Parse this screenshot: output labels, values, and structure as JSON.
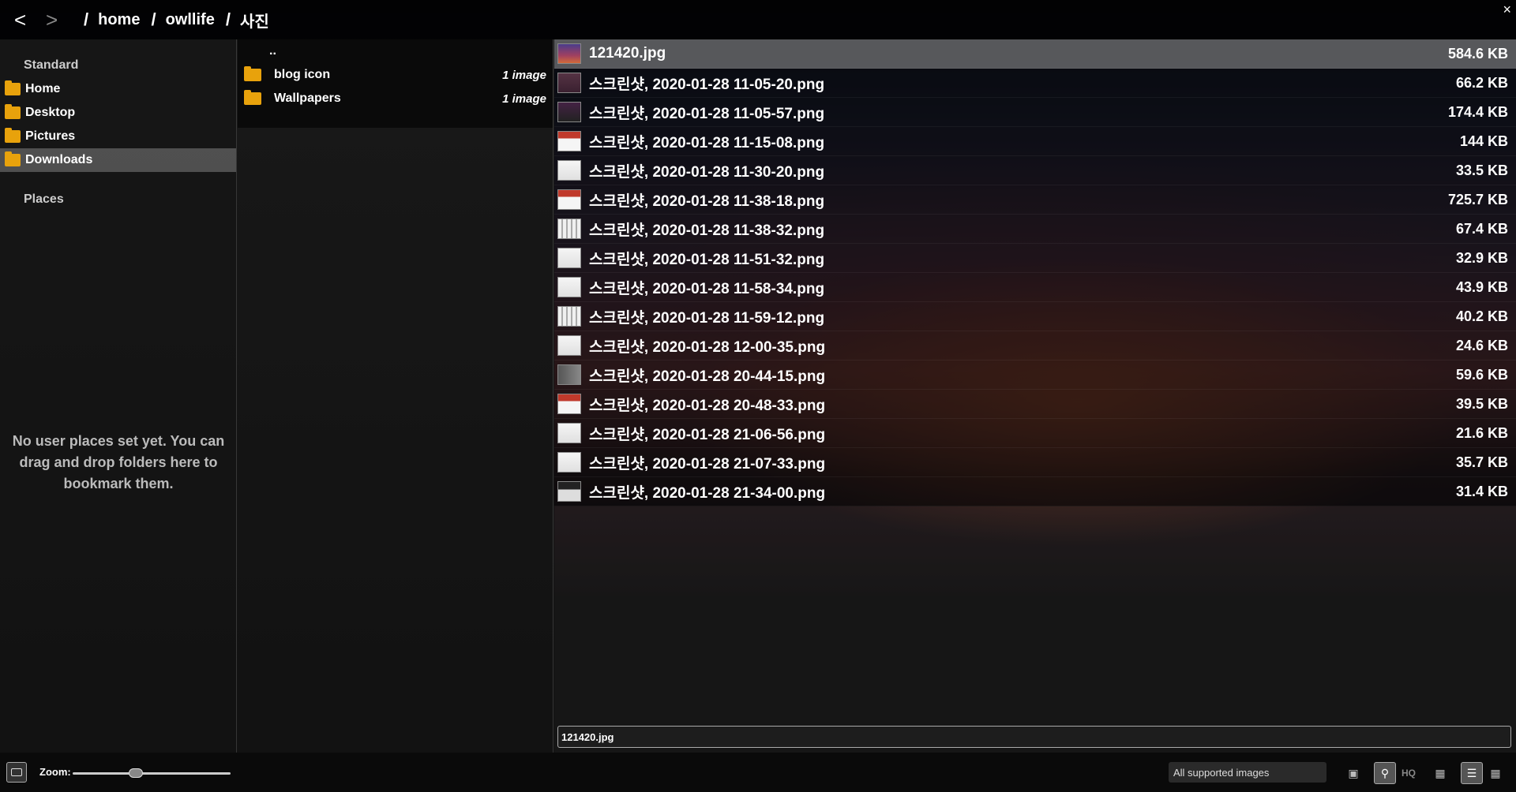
{
  "breadcrumb": {
    "back": "<",
    "forward": ">",
    "separator": "/",
    "parts": [
      "home",
      "owllife",
      "사진"
    ]
  },
  "close": "×",
  "places": {
    "standard_heading": "Standard",
    "standard_items": [
      {
        "label": "Home"
      },
      {
        "label": "Desktop"
      },
      {
        "label": "Pictures"
      },
      {
        "label": "Downloads"
      }
    ],
    "places_heading": "Places",
    "empty_message": "No user places set yet. You can drag and drop folders here to bookmark them."
  },
  "folders": {
    "parent": "..",
    "items": [
      {
        "name": "blog icon",
        "count": "1 image"
      },
      {
        "name": "Wallpapers",
        "count": "1 image"
      }
    ]
  },
  "files": [
    {
      "name": "121420.jpg",
      "size": "584.6 KB"
    },
    {
      "name": "스크린샷, 2020-01-28 11-05-20.png",
      "size": "66.2 KB"
    },
    {
      "name": "스크린샷, 2020-01-28 11-05-57.png",
      "size": "174.4 KB"
    },
    {
      "name": "스크린샷, 2020-01-28 11-15-08.png",
      "size": "144 KB"
    },
    {
      "name": "스크린샷, 2020-01-28 11-30-20.png",
      "size": "33.5 KB"
    },
    {
      "name": "스크린샷, 2020-01-28 11-38-18.png",
      "size": "725.7 KB"
    },
    {
      "name": "스크린샷, 2020-01-28 11-38-32.png",
      "size": "67.4 KB"
    },
    {
      "name": "스크린샷, 2020-01-28 11-51-32.png",
      "size": "32.9 KB"
    },
    {
      "name": "스크린샷, 2020-01-28 11-58-34.png",
      "size": "43.9 KB"
    },
    {
      "name": "스크린샷, 2020-01-28 11-59-12.png",
      "size": "40.2 KB"
    },
    {
      "name": "스크린샷, 2020-01-28 12-00-35.png",
      "size": "24.6 KB"
    },
    {
      "name": "스크린샷, 2020-01-28 20-44-15.png",
      "size": "59.6 KB"
    },
    {
      "name": "스크린샷, 2020-01-28 20-48-33.png",
      "size": "39.5 KB"
    },
    {
      "name": "스크린샷, 2020-01-28 21-06-56.png",
      "size": "21.6 KB"
    },
    {
      "name": "스크린샷, 2020-01-28 21-07-33.png",
      "size": "35.7 KB"
    },
    {
      "name": "스크린샷, 2020-01-28 21-34-00.png",
      "size": "31.4 KB"
    }
  ],
  "filename_input": {
    "value": "121420.jpg"
  },
  "bottombar": {
    "zoom_label": "Zoom:",
    "zoom_level": 0.4,
    "filter": "All supported images",
    "hq_label": "HQ"
  }
}
